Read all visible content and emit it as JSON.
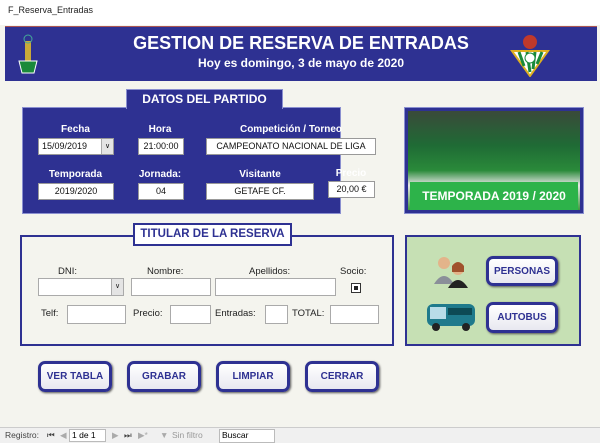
{
  "window": {
    "title": "F_Reserva_Entradas"
  },
  "header": {
    "title": "GESTION DE RESERVA DE ENTRADAS",
    "subtitle": "Hoy es domingo, 3 de mayo de 2020"
  },
  "partido": {
    "section_title": "DATOS DEL PARTIDO",
    "fecha_label": "Fecha",
    "fecha": "15/09/2019",
    "hora_label": "Hora",
    "hora": "21:00:00",
    "competicion_label": "Competición / Torneo",
    "competicion": "CAMPEONATO NACIONAL DE LIGA",
    "temporada_label": "Temporada",
    "temporada": "2019/2020",
    "jornada_label": "Jornada:",
    "jornada": "04",
    "visitante_label": "Visitante",
    "visitante": "GETAFE CF.",
    "precio_label": "Precio",
    "precio": "20,00 €"
  },
  "photo": {
    "caption": "TEMPORADA 2019 / 2020"
  },
  "titular": {
    "section_title": "TITULAR DE LA RESERVA",
    "dni_label": "DNI:",
    "nombre_label": "Nombre:",
    "apellidos_label": "Apellidos:",
    "socio_label": "Socio:",
    "telf_label": "Telf:",
    "precio_label": "Precio:",
    "entradas_label": "Entradas:",
    "total_label": "TOTAL:"
  },
  "side": {
    "personas": "PERSONAS",
    "autobus": "AUTOBUS"
  },
  "actions": {
    "ver_tabla": "VER TABLA",
    "grabar": "GRABAR",
    "limpiar": "LIMPIAR",
    "cerrar": "CERRAR"
  },
  "statusbar": {
    "registro_label": "Registro:",
    "record": "1 de 1",
    "filter": "Sin filtro",
    "search": "Buscar"
  },
  "colors": {
    "navy": "#2e3192",
    "panel_green": "#c6e0b4",
    "caption_green": "#2db34a"
  }
}
